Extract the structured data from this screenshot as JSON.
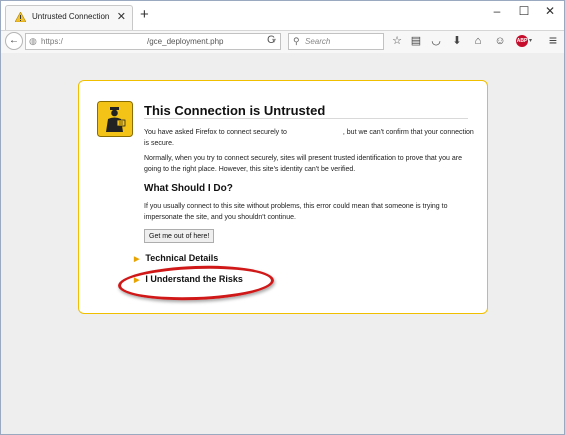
{
  "browser": {
    "tab": {
      "title": "Untrusted Connection",
      "close": "✕"
    },
    "newtab": "+",
    "window_controls": [
      "–",
      "☐",
      "✕"
    ],
    "back": "←",
    "url": {
      "prefix": "https:/",
      "path": "/gce_deployment.php",
      "dropdown": "▾"
    },
    "reload": "C",
    "search": {
      "placeholder": "Search"
    },
    "toolbar_icons": [
      {
        "name": "star-icon",
        "glyph": "☆"
      },
      {
        "name": "reading-list-icon",
        "glyph": "▤"
      },
      {
        "name": "pocket-icon",
        "glyph": "◡"
      },
      {
        "name": "downloads-icon",
        "glyph": "⬇"
      },
      {
        "name": "home-icon",
        "glyph": "⌂"
      },
      {
        "name": "chat-icon",
        "glyph": "☺"
      }
    ],
    "abp": {
      "label": "ABP",
      "caret": "▾"
    },
    "menu": "≡"
  },
  "error_page": {
    "title": "This Connection is Untrusted",
    "p1_a": "You have asked Firefox to connect securely to",
    "p1_b": ", but we can't confirm that your connection is secure.",
    "p2": "Normally, when you try to connect securely, sites will present trusted identification to prove that you are going to the right place. However, this site's identity can't be verified.",
    "h2": "What Should I Do?",
    "p3": "If you usually connect to this site without problems, this error could mean that someone is trying to impersonate the site, and you shouldn't continue.",
    "button": "Get me out of here!",
    "technical": "Technical Details",
    "risks": "I Understand the Risks",
    "arrow": "▶"
  },
  "colors": {
    "frame_border": "#f0c000",
    "highlight": "#d01818",
    "arrow": "#e8a300"
  }
}
